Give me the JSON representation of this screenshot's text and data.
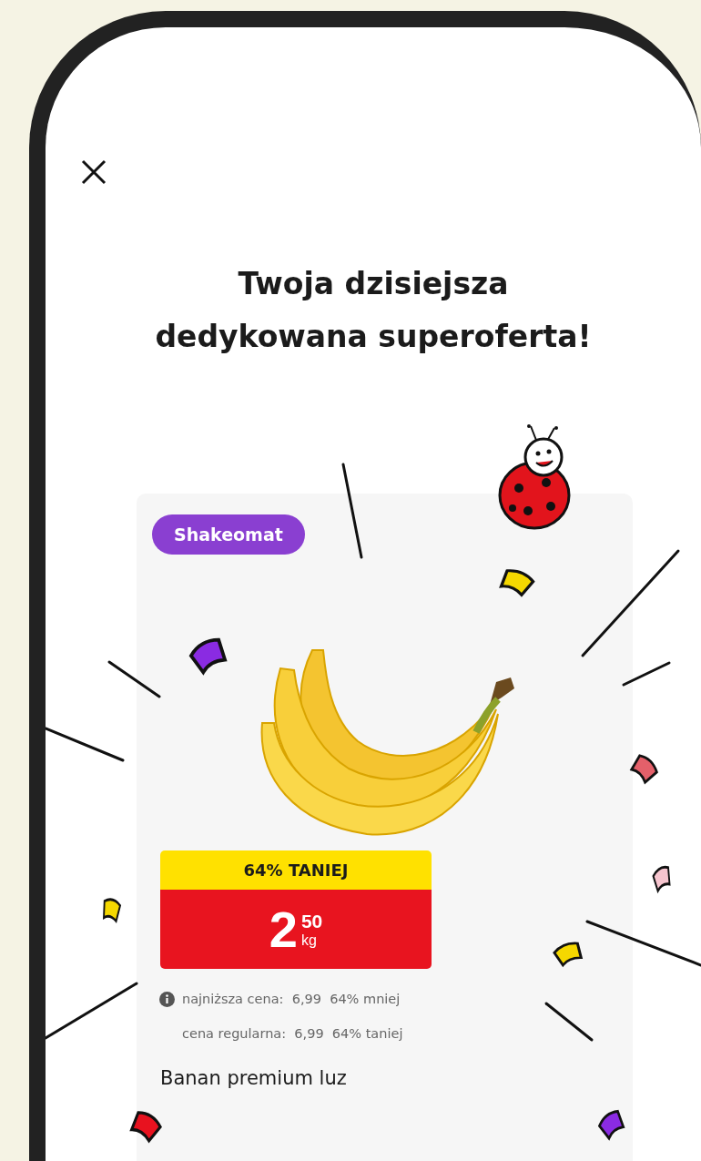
{
  "title_lines": [
    "Twoja dzisiejsza",
    "dedykowana superoferta!"
  ],
  "offer": {
    "tag": "Shakeomat",
    "discount_label": "64% TANIEJ",
    "price": {
      "whole": "2",
      "fraction": "50",
      "unit": "kg"
    },
    "price_notes": [
      {
        "label": "najniższa cena:",
        "value": "6,99",
        "difference": "64% mniej",
        "info_icon": true
      },
      {
        "label": "cena regularna:",
        "value": "6,99",
        "difference": "64% taniej",
        "info_icon": false
      }
    ],
    "product_name": "Banan premium luz"
  }
}
